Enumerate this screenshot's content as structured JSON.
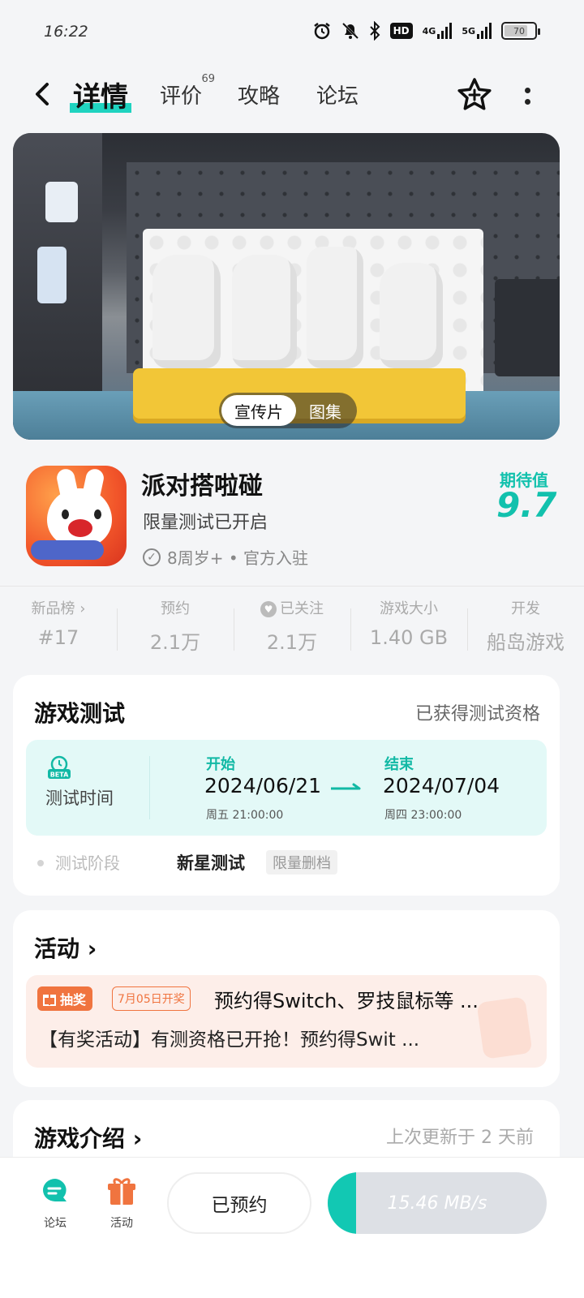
{
  "status_bar": {
    "time": "16:22",
    "hd": "HD",
    "net1": "4G",
    "net2": "5G",
    "battery": "70"
  },
  "nav": {
    "tabs": [
      {
        "label": "详情",
        "active": true
      },
      {
        "label": "评价",
        "count": "69"
      },
      {
        "label": "攻略"
      },
      {
        "label": "论坛"
      }
    ]
  },
  "hero": {
    "toggle": [
      "宣传片",
      "图集"
    ],
    "active_toggle": "宣传片"
  },
  "game": {
    "title": "派对搭啦碰",
    "subtitle": "限量测试已开启",
    "tags": "8周岁+ • 官方入驻",
    "expect_label": "期待值",
    "expect_value": "9.7"
  },
  "stats": [
    {
      "label": "新品榜 ›",
      "value": "#17"
    },
    {
      "label": "预约",
      "value": "2.1万"
    },
    {
      "label": "已关注",
      "value": "2.1万"
    },
    {
      "label": "游戏大小",
      "value": "1.40 GB"
    },
    {
      "label": "开发",
      "value": "船岛游戏"
    }
  ],
  "test_card": {
    "title": "游戏测试",
    "status": "已获得测试资格",
    "beta_badge": "BETA",
    "time_label": "测试时间",
    "start_label": "开始",
    "start_date": "2024/06/21",
    "start_time": "周五 21:00:00",
    "end_label": "结束",
    "end_date": "2024/07/04",
    "end_time": "周四 23:00:00",
    "phase_label": "测试阶段",
    "phase_value": "新星测试",
    "phase_tag": "限量删档"
  },
  "activity_card": {
    "title": "活动 ›",
    "prize_badge": "抽奖",
    "date_badge": "7月05日开奖",
    "headline": "预约得Switch、罗技鼠标等 ...",
    "desc": "【有奖活动】有测资格已开抢！预约得Swit ..."
  },
  "intro_card": {
    "title": "游戏介绍 ›",
    "updated": "上次更新于 2 天前"
  },
  "bottom_bar": {
    "forum_label": "论坛",
    "activity_label": "活动",
    "reserved_label": "已预约",
    "download_speed": "15.46 MB/s",
    "download_progress": 0.13
  },
  "colors": {
    "accent": "#12c1ad",
    "orange": "#f0743f"
  }
}
